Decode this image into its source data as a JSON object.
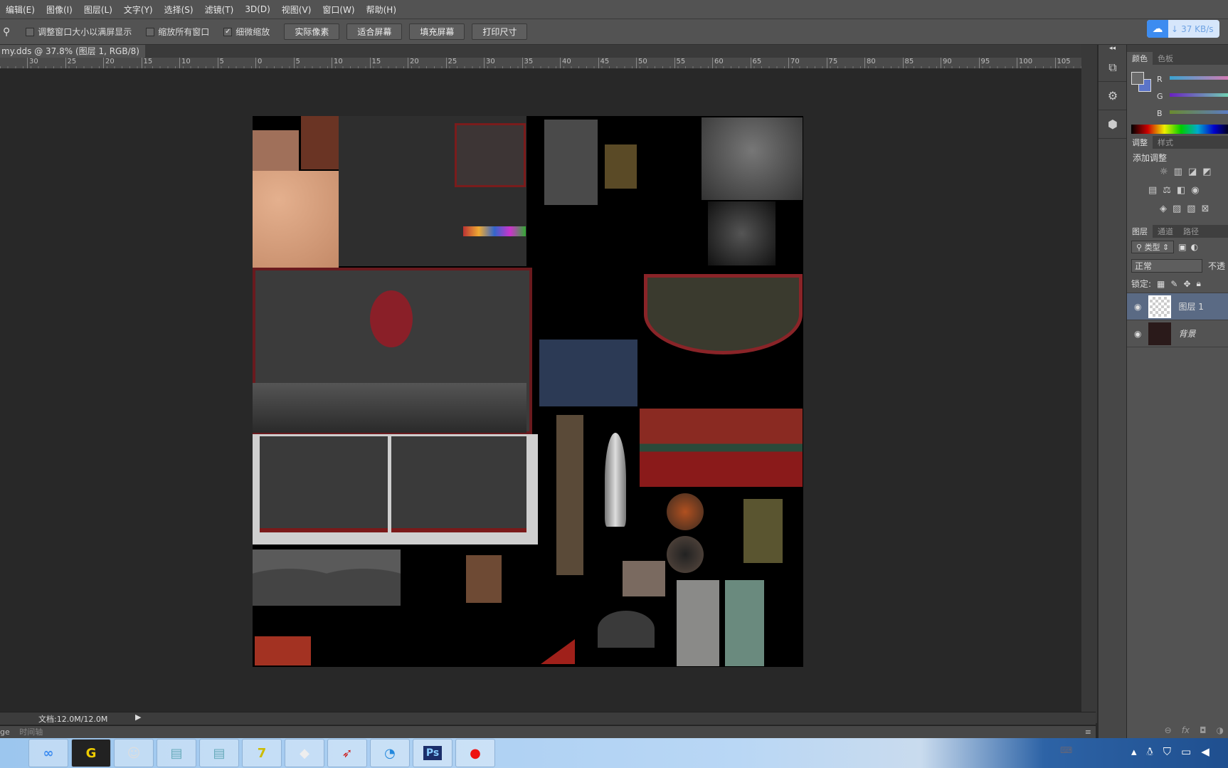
{
  "menu": [
    "编辑(E)",
    "图像(I)",
    "图层(L)",
    "文字(Y)",
    "选择(S)",
    "滤镜(T)",
    "3D(D)",
    "视图(V)",
    "窗口(W)",
    "帮助(H)"
  ],
  "options": {
    "resize_windows": {
      "label": "调整窗口大小以满屏显示",
      "checked": false
    },
    "zoom_all": {
      "label": "缩放所有窗口",
      "checked": false
    },
    "scrubby_zoom": {
      "label": "细微缩放",
      "checked": true
    },
    "buttons": [
      "实际像素",
      "适合屏幕",
      "填充屏幕",
      "打印尺寸"
    ]
  },
  "netspeed": "37 KB/s",
  "doc_tab": {
    "title": "my.dds @ 37.8% (图层 1, RGB/8) *",
    "close": "×"
  },
  "ruler_ticks": [
    "30",
    "25",
    "20",
    "15",
    "10",
    "5",
    "0",
    "5",
    "10",
    "15",
    "20",
    "25",
    "30",
    "35",
    "40",
    "45",
    "50",
    "55",
    "60",
    "65",
    "70",
    "75",
    "80",
    "85",
    "90",
    "95",
    "100",
    "105"
  ],
  "status": {
    "doc_size": "文档:12.0M/12.0M"
  },
  "timeline": {
    "left": "ge",
    "tab": "时间轴"
  },
  "color_panel": {
    "tabs": [
      "颜色",
      "色板"
    ],
    "channels": [
      "R",
      "G",
      "B"
    ],
    "fg": "#6a6a6a",
    "bg": "#5b74c8"
  },
  "adjust_panel": {
    "tabs": [
      "调整",
      "样式"
    ],
    "title": "添加调整"
  },
  "layers_panel": {
    "tabs": [
      "图层",
      "通道",
      "路径"
    ],
    "filter": "类型",
    "blend": "正常",
    "opacity_label": "不透",
    "lock_label": "锁定:",
    "layers": [
      {
        "name": "图层 1",
        "selected": true
      },
      {
        "name": "背景",
        "selected": false
      }
    ],
    "footer_fx": "fx"
  },
  "taskbar_apps": [
    "baidu-netdisk",
    "g-app",
    "avatar-app",
    "notepad",
    "notepad",
    "7-app",
    "milk-app",
    "rocket-app",
    "browser",
    "Ps",
    "recorder"
  ]
}
